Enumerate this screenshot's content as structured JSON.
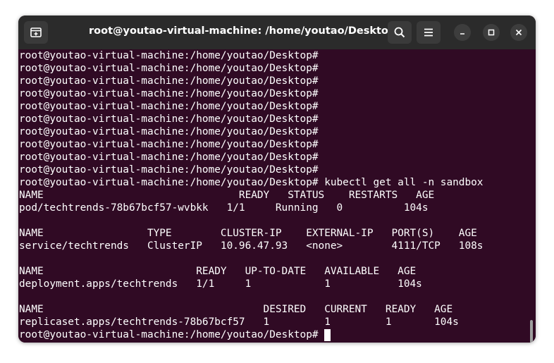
{
  "window": {
    "title": "root@youtao-virtual-machine: /home/youtao/Desktop"
  },
  "terminal": {
    "lines": [
      "root@youtao-virtual-machine:/home/youtao/Desktop#",
      "root@youtao-virtual-machine:/home/youtao/Desktop#",
      "root@youtao-virtual-machine:/home/youtao/Desktop#",
      "root@youtao-virtual-machine:/home/youtao/Desktop#",
      "root@youtao-virtual-machine:/home/youtao/Desktop#",
      "root@youtao-virtual-machine:/home/youtao/Desktop#",
      "root@youtao-virtual-machine:/home/youtao/Desktop#",
      "root@youtao-virtual-machine:/home/youtao/Desktop#",
      "root@youtao-virtual-machine:/home/youtao/Desktop#",
      "root@youtao-virtual-machine:/home/youtao/Desktop#",
      "root@youtao-virtual-machine:/home/youtao/Desktop# kubectl get all -n sandbox",
      "NAME                                READY   STATUS    RESTARTS   AGE",
      "pod/techtrends-78b67bcf57-wvbkk   1/1     Running   0          104s",
      "",
      "NAME                 TYPE        CLUSTER-IP    EXTERNAL-IP   PORT(S)    AGE",
      "service/techtrends   ClusterIP   10.96.47.93   <none>        4111/TCP   108s",
      "",
      "NAME                         READY   UP-TO-DATE   AVAILABLE   AGE",
      "deployment.apps/techtrends   1/1     1            1           104s",
      "",
      "NAME                                    DESIRED   CURRENT   READY   AGE",
      "replicaset.apps/techtrends-78b67bcf57   1         1         1       104s"
    ],
    "current_prompt": "root@youtao-virtual-machine:/home/youtao/Desktop# "
  },
  "icons": {
    "new_tab": "new-tab-icon",
    "search": "search-icon",
    "menu": "hamburger-menu-icon",
    "minimize": "minimize-icon",
    "maximize": "maximize-icon",
    "close": "close-icon"
  },
  "colors": {
    "terminal_background": "#300a24",
    "titlebar_background": "#2b2b2b",
    "text": "#ffffff"
  }
}
